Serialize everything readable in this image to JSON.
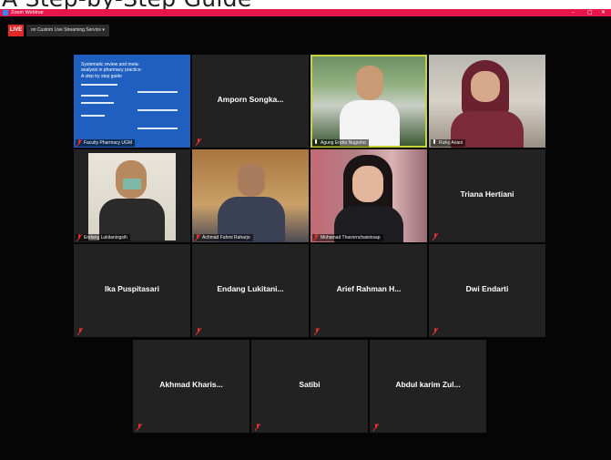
{
  "banner": {
    "text": "A Step-by-Step Guide"
  },
  "window": {
    "title": "Zoom Webinar",
    "minimize": "–",
    "maximize": "□",
    "close": "✕"
  },
  "toolbar": {
    "live_label": "LIVE",
    "stream_label": "on Custom Live Streaming Service ▾"
  },
  "tiles": [
    {
      "name": "",
      "nameplate": "Faculty Pharmacy UGM",
      "kind": "slide",
      "slide": {
        "title": "Systematic review and meta-analysis in pharmacy practice:",
        "subtitle": "A step by step guide"
      }
    },
    {
      "name": "Amporn Songka...",
      "nameplate": "",
      "kind": "name"
    },
    {
      "name": "",
      "nameplate": "Agung Endro Nugroho",
      "kind": "video",
      "active": true
    },
    {
      "name": "",
      "nameplate": "Rizky Ariani",
      "kind": "video"
    },
    {
      "name": "",
      "nameplate": "Endang Lukitaningsih",
      "kind": "video"
    },
    {
      "name": "",
      "nameplate": "Achmad Fahmi Raharjo",
      "kind": "video"
    },
    {
      "name": "",
      "nameplate": "Mohamad Thavornchaisinsap",
      "kind": "video"
    },
    {
      "name": "Triana Hertiani",
      "nameplate": "",
      "kind": "name"
    },
    {
      "name": "Ika Puspitasari",
      "nameplate": "",
      "kind": "name"
    },
    {
      "name": "Endang Lukitani...",
      "nameplate": "",
      "kind": "name"
    },
    {
      "name": "Arief Rahman H...",
      "nameplate": "",
      "kind": "name"
    },
    {
      "name": "Dwi Endarti",
      "nameplate": "",
      "kind": "name"
    },
    {
      "name": "Akhmad Kharis...",
      "nameplate": "",
      "kind": "name"
    },
    {
      "name": "Satibi",
      "nameplate": "",
      "kind": "name"
    },
    {
      "name": "Abdul karim Zul...",
      "nameplate": "",
      "kind": "name"
    }
  ],
  "colors": {
    "titlebar": "#e8154a",
    "tile": "#222222",
    "active_border": "#c8d33a",
    "live": "#e02828",
    "mic_muted": "#e03030"
  },
  "icons": {
    "mic": "mic-muted-icon",
    "app": "zoom-icon"
  }
}
